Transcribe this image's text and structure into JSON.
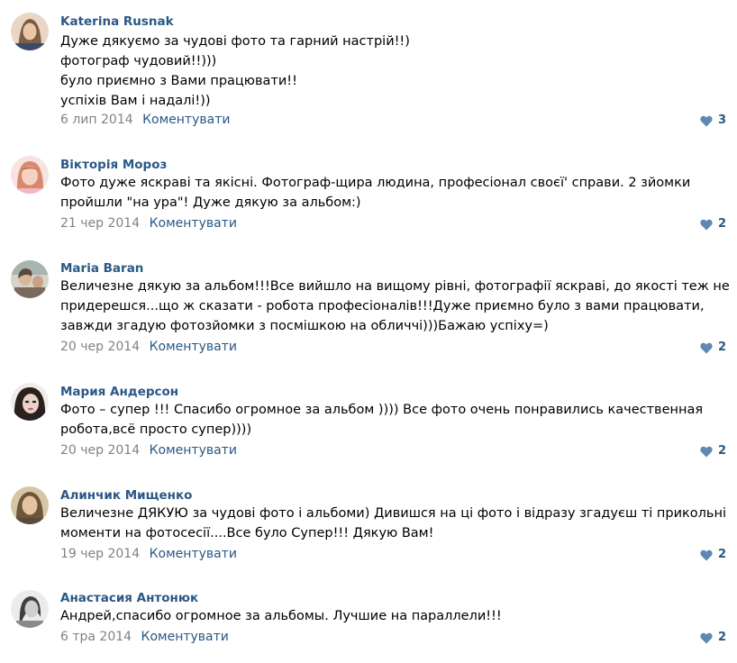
{
  "comments": [
    {
      "author": "Katerina Rusnak",
      "lines": [
        "Дуже дякуємо за чудові фото та гарний настрій!!)",
        "фотограф чудовий!!)))",
        "було приємно з Вами працювати!!",
        "успіхів Вам і надалі!))"
      ],
      "date": "6 лип 2014",
      "reply_label": "Коментувати",
      "likes": "3",
      "avatar_colors": [
        "#c9a27a",
        "#6b4a2f"
      ]
    },
    {
      "author": "Вікторія Мороз",
      "lines": [
        "Фото дуже яскраві та якісні. Фотограф-щира людина, професіонал своєї' справи. 2 зйомки",
        "пройшли \"на ура\"! Дуже дякую за альбом:)"
      ],
      "date": "21 чер 2014",
      "reply_label": "Коментувати",
      "likes": "2",
      "avatar_colors": [
        "#f2c6c0",
        "#d9896b"
      ]
    },
    {
      "author": "Maria Baran",
      "lines": [
        "Величезне дякую за альбом!!!Все вийшло на вищому рівні, фотографії яскраві, до якості теж не",
        "придерешся...що ж сказати - робота професіоналів!!!Дуже приємно було з вами працювати,",
        "завжди згадую фотозйомки з посмішкою на обличчі)))Бажаю успіху=)"
      ],
      "date": "20 чер 2014",
      "reply_label": "Коментувати",
      "likes": "2",
      "avatar_colors": [
        "#b8b0a4",
        "#5b4a3c"
      ]
    },
    {
      "author": "Мария Андерсон",
      "lines": [
        "Фото – супер !!! Спасибо огромное за альбом )))) Все фото очень понравились качественная",
        "робота,всё просто супер))))"
      ],
      "date": "20 чер 2014",
      "reply_label": "Коментувати",
      "likes": "2",
      "avatar_colors": [
        "#e8dcd8",
        "#2a2020"
      ]
    },
    {
      "author": "Алинчик Мищенко",
      "lines": [
        "Величезне ДЯКУЮ за чудові фото і альбоми) Дивишся на ці фото і відразу згадуєш ті прикольні",
        "моменти на фотосесії....Все було Супер!!! Дякую Вам!"
      ],
      "date": "19 чер 2014",
      "reply_label": "Коментувати",
      "likes": "2",
      "avatar_colors": [
        "#c8b08a",
        "#6e5537"
      ]
    },
    {
      "author": "Анастасия Антонюк",
      "lines": [
        "Андрей,спасибо огромное за альбомы. Лучшие на параллели!!!"
      ],
      "date": "6 тра 2014",
      "reply_label": "Коментувати",
      "likes": "2",
      "avatar_colors": [
        "#e4e4e4",
        "#404040"
      ]
    }
  ],
  "colors": {
    "link": "#2a5885",
    "muted": "#828282",
    "heart": "#5f88b4"
  }
}
